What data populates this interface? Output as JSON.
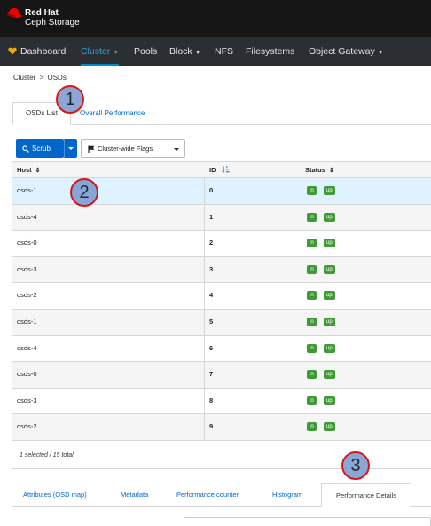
{
  "brand": {
    "line1": "Red Hat",
    "line2": "Ceph Storage"
  },
  "nav": {
    "dashboard": "Dashboard",
    "cluster": "Cluster",
    "pools": "Pools",
    "block": "Block",
    "nfs": "NFS",
    "filesystems": "Filesystems",
    "object_gateway": "Object Gateway"
  },
  "breadcrumb": {
    "parent": "Cluster",
    "separator": ">",
    "current": "OSDs"
  },
  "tabs": {
    "osds_list": "OSDs List",
    "overall_performance": "Overall Performance"
  },
  "toolbar": {
    "scrub": "Scrub",
    "flags": "Cluster-wide Flags"
  },
  "table": {
    "headers": {
      "host": "Host",
      "id": "ID",
      "status": "Status"
    },
    "rows": [
      {
        "host": "osds-1",
        "id": "0",
        "status": [
          "in",
          "up"
        ]
      },
      {
        "host": "osds-4",
        "id": "1",
        "status": [
          "in",
          "up"
        ]
      },
      {
        "host": "osds-0",
        "id": "2",
        "status": [
          "in",
          "up"
        ]
      },
      {
        "host": "osds-3",
        "id": "3",
        "status": [
          "in",
          "up"
        ]
      },
      {
        "host": "osds-2",
        "id": "4",
        "status": [
          "in",
          "up"
        ]
      },
      {
        "host": "osds-1",
        "id": "5",
        "status": [
          "in",
          "up"
        ]
      },
      {
        "host": "osds-4",
        "id": "6",
        "status": [
          "in",
          "up"
        ]
      },
      {
        "host": "osds-0",
        "id": "7",
        "status": [
          "in",
          "up"
        ]
      },
      {
        "host": "osds-3",
        "id": "8",
        "status": [
          "in",
          "up"
        ]
      },
      {
        "host": "osds-2",
        "id": "9",
        "status": [
          "in",
          "up"
        ]
      }
    ],
    "footer": "1 selected / 15 total"
  },
  "detail_tabs": {
    "attributes": "Attributes (OSD map)",
    "metadata": "Metadata",
    "perf_counter": "Performance counter",
    "histogram": "Histogram",
    "perf_details": "Performance Details"
  },
  "markers": [
    "1",
    "2",
    "3"
  ],
  "colors": {
    "accent": "#0066cc",
    "status_green": "#3f9c35",
    "selected_row": "#def3ff",
    "masthead": "#151515"
  }
}
